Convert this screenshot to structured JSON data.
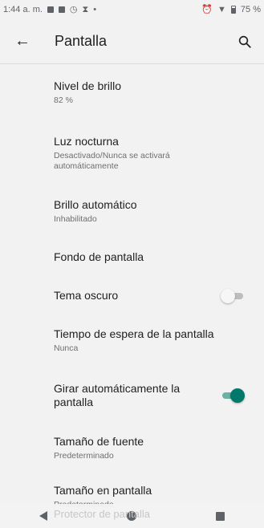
{
  "status_bar": {
    "time": "1:44 a. m.",
    "battery": "75 %"
  },
  "app_bar": {
    "title": "Pantalla"
  },
  "items": [
    {
      "title": "Nivel de brillo",
      "subtitle": "82 %"
    },
    {
      "title": "Luz nocturna",
      "subtitle": "Desactivado/Nunca se activará automáticamente"
    },
    {
      "title": "Brillo automático",
      "subtitle": "Inhabilitado"
    },
    {
      "title": "Fondo de pantalla"
    },
    {
      "title": "Tema oscuro",
      "toggle": false
    },
    {
      "title": "Tiempo de espera de la pantalla",
      "subtitle": "Nunca"
    },
    {
      "title": "Girar automáticamente la pantalla",
      "toggle": true
    },
    {
      "title": "Tamaño de fuente",
      "subtitle": "Predeterminado"
    },
    {
      "title": "Tamaño en pantalla",
      "subtitle": "Predeterminado"
    }
  ],
  "peek_item": "Protector de pantalla",
  "colors": {
    "toggle_on": "#00796b",
    "background": "#f2f2f2"
  }
}
